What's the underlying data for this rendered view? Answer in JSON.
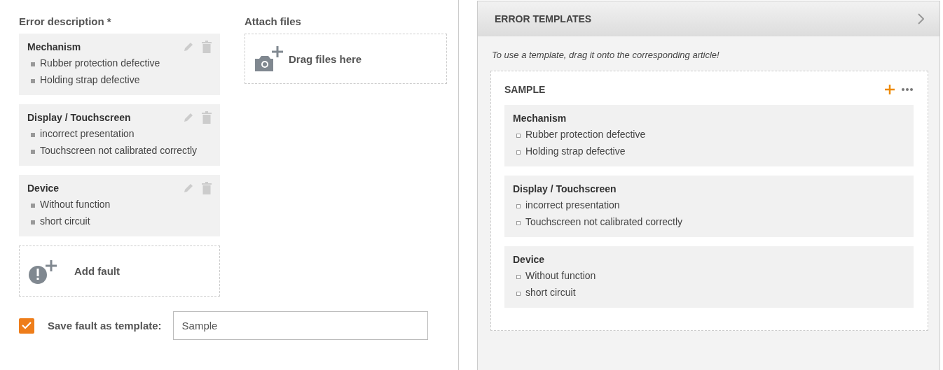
{
  "error_description": {
    "label": "Error description *",
    "faults": [
      {
        "title": "Mechanism",
        "items": [
          "Rubber protection defective",
          "Holding strap defective"
        ]
      },
      {
        "title": "Display / Touchscreen",
        "items": [
          "incorrect presentation",
          "Touchscreen not calibrated correctly"
        ]
      },
      {
        "title": "Device",
        "items": [
          "Without function",
          "short circuit"
        ]
      }
    ],
    "add_fault": "Add fault"
  },
  "attach_files": {
    "label": "Attach files",
    "dropzone": "Drag files here"
  },
  "save_template": {
    "label": "Save fault as template:",
    "checked": true,
    "value": "Sample"
  },
  "templates_panel": {
    "title": "ERROR TEMPLATES",
    "hint": "To use a template, drag it onto the corresponding article!",
    "groups": [
      {
        "name": "SAMPLE",
        "faults": [
          {
            "title": "Mechanism",
            "items": [
              "Rubber protection defective",
              "Holding strap defective"
            ]
          },
          {
            "title": "Display / Touchscreen",
            "items": [
              "incorrect presentation",
              "Touchscreen not calibrated correctly"
            ]
          },
          {
            "title": "Device",
            "items": [
              "Without function",
              "short circuit"
            ]
          }
        ]
      }
    ]
  }
}
